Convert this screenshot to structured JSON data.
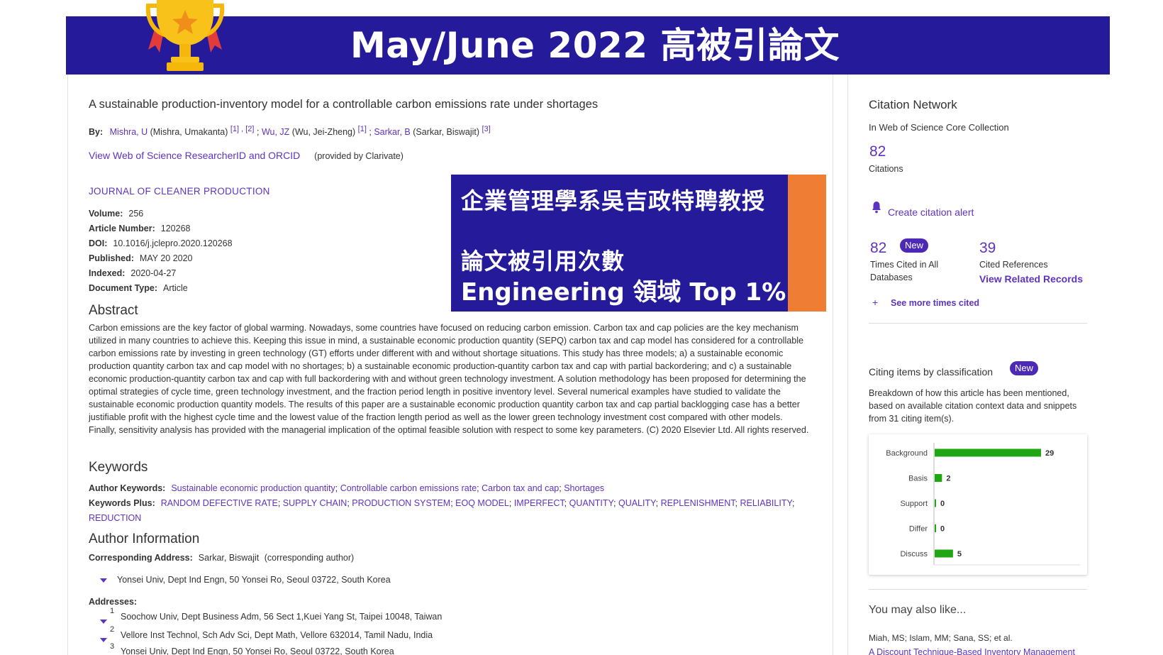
{
  "banner": {
    "title": "May/June 2022 高被引論文"
  },
  "article": {
    "title": "A sustainable production-inventory model for a controllable carbon emissions rate under shortages",
    "by_label": "By:",
    "authors": [
      {
        "link": "Mishra, U",
        "full": "(Mishra, Umakanta)",
        "refs": "[1] , [2]",
        "sep": ";"
      },
      {
        "link": "Wu, JZ",
        "full": "(Wu, Jei-Zheng)",
        "refs": "[1]",
        "sep": ";"
      },
      {
        "link": "Sarkar, B",
        "full": "(Sarkar, Biswajit)",
        "refs": "[3]",
        "sep": ""
      }
    ],
    "researcher_link": "View Web of Science ResearcherID and ORCID",
    "provided": "(provided by Clarivate)",
    "journal": "JOURNAL OF CLEANER PRODUCTION",
    "meta": [
      {
        "key": "Volume:",
        "value": "256"
      },
      {
        "key": "Article Number:",
        "value": "120268"
      },
      {
        "key": "DOI:",
        "value": "10.1016/j.jclepro.2020.120268"
      },
      {
        "key": "Published:",
        "value": "MAY 20 2020"
      },
      {
        "key": "Indexed:",
        "value": "2020-04-27"
      },
      {
        "key": "Document Type:",
        "value": "Article"
      }
    ]
  },
  "highlight": {
    "line1": "企業管理學系吳吉政特聘教授",
    "line2": "論文被引用次數",
    "line3": "Engineering 領域 Top 1%"
  },
  "abstract": {
    "heading": "Abstract",
    "text": "Carbon emissions are the key factor of global warming. Nowadays, some countries have focused on reducing carbon emission. Carbon tax and cap policies are the key mechanism utilized in many countries to achieve this. Keeping this issue in mind, a sustainable economic production quantity (SEPQ) carbon tax and cap model has considered for a controllable carbon emissions rate by investing in green technology (GT) efforts under different with and without shortage situations. This study has three models; a) a sustainable economic production quantity carbon tax and cap model with no shortages; b) a sustainable economic production-quantity carbon tax and cap with partial backordering; and c) a sustainable economic production-quantity carbon tax and cap with full backordering with and without green technology investment. A solution methodology has been proposed for determining the optimal strategies of cycle time, green technology investment, and the fraction period length in positive inventory level. Several numerical examples have studied to validate the sustainable economic production quantity models. The results of this paper are a sustainable economic production quantity carbon tax and cap partial backlogging case has a better justifiable profit with the highest cycle time and the lowest value of the fraction length period as well as the lower green technology investment cost compared with other models. Finally, sensitivity analysis has provided with the managerial implication of the optimal feasible solution with respect to some key parameters. (C) 2020 Elsevier Ltd. All rights reserved."
  },
  "keywords": {
    "heading": "Keywords",
    "author_label": "Author Keywords:",
    "author": [
      "Sustainable economic production quantity",
      "Controllable carbon emissions rate",
      "Carbon tax and cap",
      "Shortages"
    ],
    "plus_label": "Keywords Plus:",
    "plus": [
      "RANDOM DEFECTIVE RATE",
      "SUPPLY CHAIN",
      "PRODUCTION SYSTEM",
      "EOQ MODEL",
      "IMPERFECT",
      "QUANTITY",
      "QUALITY",
      "REPLENISHMENT",
      "RELIABILITY",
      "REDUCTION"
    ]
  },
  "author_info": {
    "heading": "Author Information",
    "corr_label": "Corresponding Address:",
    "corr_name": "Sarkar, Biswajit",
    "corr_note": "(corresponding author)",
    "corr_address": "Yonsei Univ, Dept Ind Engn, 50 Yonsei Ro, Seoul 03722, South Korea",
    "addresses_label": "Addresses:",
    "addresses": [
      {
        "num": "1",
        "text": "Soochow Univ, Dept Business Adm, 56 Sect 1,Kuei Yang St, Taipei 10048, Taiwan"
      },
      {
        "num": "2",
        "text": "Vellore Inst Technol, Sch Adv Sci, Dept Math, Vellore 632014, Tamil Nadu, India"
      },
      {
        "num": "3",
        "text": "Yonsei Univ, Dept Ind Engn, 50 Yonsei Ro, Seoul 03722, South Korea"
      }
    ]
  },
  "citation_network": {
    "title": "Citation Network",
    "subtitle": "In Web of Science Core Collection",
    "citations": "82",
    "citations_label": "Citations",
    "alert": "Create citation alert",
    "times_cited": "82",
    "new_badge": "New",
    "times_cited_label_1": "Times Cited in All",
    "times_cited_label_2": "Databases",
    "cited_refs": "39",
    "cited_refs_label": "Cited References",
    "related": "View Related Records",
    "see_more": "See more times cited",
    "plus": "+"
  },
  "classification": {
    "title": "Citing items by classification",
    "badge": "New",
    "desc": "Breakdown of how this article has been mentioned, based on available citation context data and snippets from 31 citing item(s)."
  },
  "chart_data": {
    "type": "bar",
    "orientation": "horizontal",
    "categories": [
      "Background",
      "Basis",
      "Support",
      "Differ",
      "Discuss"
    ],
    "values": [
      29,
      2,
      0,
      0,
      5
    ],
    "xlim": [
      0,
      29
    ],
    "grid": false,
    "bar_color": "#1fa612"
  },
  "also": {
    "heading": "You may also like...",
    "authors": "Miah, MS; Islam, MM; Sana, SS; et al.",
    "title": "A Discount Technique-Based Inventory Management"
  },
  "colors": {
    "banner": "#241a9a",
    "accent": "#ef7d34",
    "link": "#5e33bf",
    "bar": "#1fa612"
  }
}
